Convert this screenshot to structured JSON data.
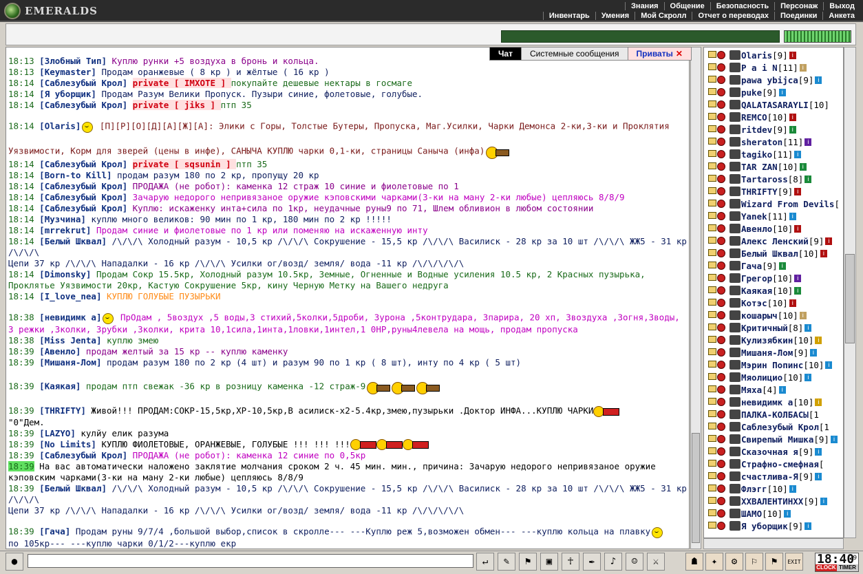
{
  "app": {
    "logo_text": "EMERALDS"
  },
  "menu": {
    "top": [
      "Знания",
      "Общение",
      "Безопасность",
      "Персонаж",
      "Выход"
    ],
    "sub": [
      "Инвентарь",
      "Умения",
      "Мой Скролл",
      "Отчет о переводах",
      "Поединки",
      "Анкета"
    ]
  },
  "tabs": [
    {
      "label": "Чат"
    },
    {
      "label": "Системные сообщения"
    },
    {
      "label": "Приваты"
    }
  ],
  "tab_close": "✕",
  "chat": [
    {
      "ts": "18:13",
      "nick": "[Злобный Тип]",
      "msg": " Куплю рунки +5 воздуха в бронь и кольца."
    },
    {
      "ts": "18:13",
      "nick": "[Keymaster]",
      "msg": " Продам оранжевые ( 8 кр ) и жёлтые ( 16 кр )"
    },
    {
      "ts": "18:14",
      "nick": "[Саблезубый Крол]",
      "priv": " private [ IMXOTE ] ",
      "msg": " покупайте дешевые нектары в госмаге"
    },
    {
      "ts": "18:14",
      "nick": "[Я уборщик]",
      "msg": " Продам Разум Велики Пропуск. Пузыри синие, фолетовые, голубые."
    },
    {
      "ts": "18:14",
      "nick": "[Саблезубый Крол]",
      "priv": " private [ jiks ] ",
      "msg": " птп 35"
    },
    {
      "ts": "18:14",
      "nick": "[Olaris]",
      "msg": "  [П][Р][О][Д][А][Ж][А]: Элики с Горы, Толстые Бутеры, Пропуска, Маг.Усилки, Чарки Демонса 2-ки,3-ки и Проклятия"
    },
    {
      "msg": "Уязвимости, Корм для зверей (цены в инфе), САНЫЧА  КУПЛЮ чарки 0,1-ки, страницы Саныча (инфа)"
    },
    {
      "ts": "18:14",
      "nick": "[Саблезубый Крол]",
      "priv": " private [ sqsunin ] ",
      "msg": " птп 35"
    },
    {
      "ts": "18:14",
      "nick": "[Born-to Kill]",
      "msg": " продам разум 180 по 2 кр, пропущу 20 кр"
    },
    {
      "ts": "18:14",
      "nick": "[Саблезубый Крол]",
      "msg": " ПРОДАЖА (не робот): каменка 12 страж 10 синие и фиолетовые по 1"
    },
    {
      "ts": "18:14",
      "nick": "[Саблезубый Крол]",
      "msg": " Зачарую недорого непривязаное оружие кэповскими чарками(3-ки на ману 2-ки любые) цепляюсь 8/8/9"
    },
    {
      "ts": "18:14",
      "nick": "[Саблезубый Крол]",
      "msg": " Куплю: искаженку инта+сила по 1кр, неудачные руны9 по 71, Шлем обливион в любом состоянии"
    },
    {
      "ts": "18:14",
      "nick": "[Музчина]",
      "msg": " куплю много великов: 90 мин по 1 кр, 180 мин по 2 кр !!!!!"
    },
    {
      "ts": "18:14",
      "nick": "[mrrekrut]",
      "msg": " Продам синие и фиолетовые по 1 кр или поменяю на искаженную инту"
    },
    {
      "ts": "18:14",
      "nick": "[Белый Шквал]",
      "msg": " /\\/\\/\\ Холодный разум - 10,5 кр /\\/\\/\\ Сокрушение - 15,5 кр /\\/\\/\\ Василиск - 28 кр за 10 шт /\\/\\/\\ ЖЖ5 - 31 кр /\\/\\/\\"
    },
    {
      "msg": "Цепи 37 кр /\\/\\/\\ Нападалки - 16 кр /\\/\\/\\ Усилки ог/возд/ земля/ вода -11 кр /\\/\\/\\/\\/\\"
    },
    {
      "ts": "18:14",
      "nick": "[Dimonsky]",
      "msg": " Продам Сокр 15.5кр, Холодный разум 10.5кр, Земные, Огненные и Водные усиления 10.5 кр, 2 Красных пузырька,"
    },
    {
      "msg": "Проклятье Уязвимости 20кр, Кастую Сокрушение 5кр, кину Черную Метку на Вашего недруга"
    },
    {
      "ts": "18:14",
      "nick": "[I_love_nea]",
      "msg": " КУПЛЮ ГОЛУБЫЕ ПУЗЫРЬКИ"
    },
    {
      "ts": "18:38",
      "nick": "[невидимк а]",
      "msg": " ПрОдам  , 5воздух ,5 воды,3 стихий,5колки,5дроби, Зурона ,5контрудара, 3парира, 20 хп,  Звоздуха ,Зогня,Зводы,"
    },
    {
      "msg": "3 режки ,Зколки, Зрубки ,3колки, крита 10,1сила,1инта,1ловки,1интел,1 0НР,руны4левела на мощь, продам пропуска"
    },
    {
      "ts": "18:38",
      "nick": "[Miss Jenta]",
      "msg": " куплю змею"
    },
    {
      "ts": "18:39",
      "nick": "[Авенло]",
      "msg": " продам желтый за 15 кр -- куплю каменку"
    },
    {
      "ts": "18:39",
      "nick": "[Мишаня-Лом]",
      "msg": " продам разум 180 по 2 кр (4 шт) и разум 90 по 1 кр ( 8 шт), инту по 4 кр ( 5 шт)"
    },
    {
      "ts": "18:39",
      "nick": "[Каякая]",
      "msg": " продам птп свежак -36 кр в розницу каменка -12 страж-9"
    },
    {
      "ts": "18:39",
      "nick": "[THRIFTY]",
      "msg": " Живой!!! ПРОДАМ:СОКР-15,5кр,ХР-10,5кр,В асилиск-х2-5.4кр,змею,пузырьки .Доктор   ИНФА...КУПЛЮ ЧАРКИ"
    },
    {
      "msg": "\"0\"Дем."
    },
    {
      "ts": "18:39",
      "nick": "[LAZYO]",
      "msg": " кулйу елик разума"
    },
    {
      "ts": "18:39",
      "nick": "[No Limits]",
      "msg": " КУПЛЮ ФИОЛЕТОВЫЕ, ОРАНЖЕВЫЕ, ГОЛУБЫЕ !!! !!! !!!"
    },
    {
      "ts": "18:39",
      "nick": "[Саблезубый Крол]",
      "msg": " ПРОДАЖА (не робот): каменка 12 синие по 0,5кр"
    },
    {
      "ts": "18:39",
      "msg": " На вас автоматически наложено заклятие молчания сроком 2 ч. 45 мин. мин., причина: Зачарую недорого непривязаное оружие"
    },
    {
      "msg": "кэповским чарками(3-ки на ману 2-ки любые) цепляюсь 8/8/9"
    },
    {
      "ts": "18:39",
      "nick": "[Белый Шквал]",
      "msg": " /\\/\\/\\ Холодный разум - 10,5 кр /\\/\\/\\ Сокрушение - 15,5 кр /\\/\\/\\ Василиск - 28 кр за 10 шт /\\/\\/\\ ЖЖ5 - 31 кр /\\/\\/\\"
    },
    {
      "msg": "Цепи 37 кр /\\/\\/\\ Нападалки - 16 кр /\\/\\/\\ Усилки ог/возд/ земля/ вода -11 кр /\\/\\/\\/\\/\\"
    },
    {
      "ts": "18:39",
      "nick": "[Гача]",
      "msg": " Продам руны 9/7/4 ,большой выбор,список в скролле--- ---Куплю реж 5,возможен обмен---        ---куплю кольца на плавку"
    },
    {
      "msg": "по 105кр--- ---куплю чарки 0/1/2---куплю екр"
    }
  ],
  "users": [
    {
      "name": "Olaris",
      "lvl": "[9]",
      "info": "red"
    },
    {
      "name": "P a i N",
      "lvl": "[11]",
      "info": "tan"
    },
    {
      "name": "pawa ybijca",
      "lvl": "[9]",
      "info": "blue"
    },
    {
      "name": "puke",
      "lvl": "[9]",
      "info": "blue"
    },
    {
      "name": "QALATASARAYLI",
      "lvl": "[10]",
      "info": ""
    },
    {
      "name": "REMCO",
      "lvl": "[10]",
      "info": "red"
    },
    {
      "name": "ritdev",
      "lvl": "[9]",
      "info": "green"
    },
    {
      "name": "sheraton",
      "lvl": "[11]",
      "info": "purple"
    },
    {
      "name": "tagiko",
      "lvl": "[11]",
      "info": "blue"
    },
    {
      "name": "TAR ZAN",
      "lvl": "[10]",
      "info": "green"
    },
    {
      "name": "Tartaross",
      "lvl": "[8]",
      "info": "green"
    },
    {
      "name": "THRIFTY",
      "lvl": "[9]",
      "info": "red"
    },
    {
      "name": "Wizard From Devils",
      "lvl": "[",
      "info": ""
    },
    {
      "name": "Yanek",
      "lvl": "[11]",
      "info": "blue"
    },
    {
      "name": "Авенло",
      "lvl": "[10]",
      "info": "red"
    },
    {
      "name": "Алекс Ленский",
      "lvl": "[9]",
      "info": "red"
    },
    {
      "name": "Белый Шквал",
      "lvl": "[10]",
      "info": "red"
    },
    {
      "name": "Гача",
      "lvl": "[9]",
      "info": "green"
    },
    {
      "name": "Грегор",
      "lvl": "[10]",
      "info": "purple"
    },
    {
      "name": "Каякая",
      "lvl": "[10]",
      "info": "green"
    },
    {
      "name": "Котэс",
      "lvl": "[10]",
      "info": "red"
    },
    {
      "name": "кошарыч",
      "lvl": "[10]",
      "info": "tan"
    },
    {
      "name": "Критичный",
      "lvl": "[8]",
      "info": "blue"
    },
    {
      "name": "Кулизябкин",
      "lvl": "[10]",
      "info": "yellow"
    },
    {
      "name": "Мишаня-Лом",
      "lvl": "[9]",
      "info": "blue"
    },
    {
      "name": "Мэрин Попинс",
      "lvl": "[10]",
      "info": "blue"
    },
    {
      "name": "Мяолицио",
      "lvl": "[10]",
      "info": "blue"
    },
    {
      "name": "Мяха",
      "lvl": "[4]",
      "info": "blue"
    },
    {
      "name": "невидимк а",
      "lvl": "[10]",
      "info": "yellow"
    },
    {
      "name": "ПАЛКА-КОЛБАСЫ",
      "lvl": "[1",
      "info": ""
    },
    {
      "name": "Саблезубый Крол",
      "lvl": "[1",
      "info": ""
    },
    {
      "name": "Свирепый Мишка",
      "lvl": "[9]",
      "info": "blue"
    },
    {
      "name": "Сказочная я",
      "lvl": "[9]",
      "info": "blue"
    },
    {
      "name": "Страфно-смефная",
      "lvl": "[",
      "info": ""
    },
    {
      "name": "счастлива-Я",
      "lvl": "[9]",
      "info": "blue"
    },
    {
      "name": "Флэгг",
      "lvl": "[10]",
      "info": "blue"
    },
    {
      "name": "XXВАЛЕНТИНХХ",
      "lvl": "[9]",
      "info": "blue"
    },
    {
      "name": "ШАМО",
      "lvl": "[10]",
      "info": "blue"
    },
    {
      "name": "Я уборщик",
      "lvl": "[9]",
      "info": "blue"
    }
  ],
  "info_glyph": "i",
  "clock": {
    "time": "18:40",
    "sec": "29",
    "lbl_a": "CLOCK",
    "lbl_b": "TIMER"
  },
  "bottom_buttons": [
    "↵",
    "✎",
    "⚑",
    "▣",
    "☥",
    "✒",
    "♪",
    "☺",
    "⚔"
  ],
  "right_buttons": [
    "☗",
    "✦",
    "⚙",
    "⚐",
    "⚑",
    "EXIT"
  ]
}
